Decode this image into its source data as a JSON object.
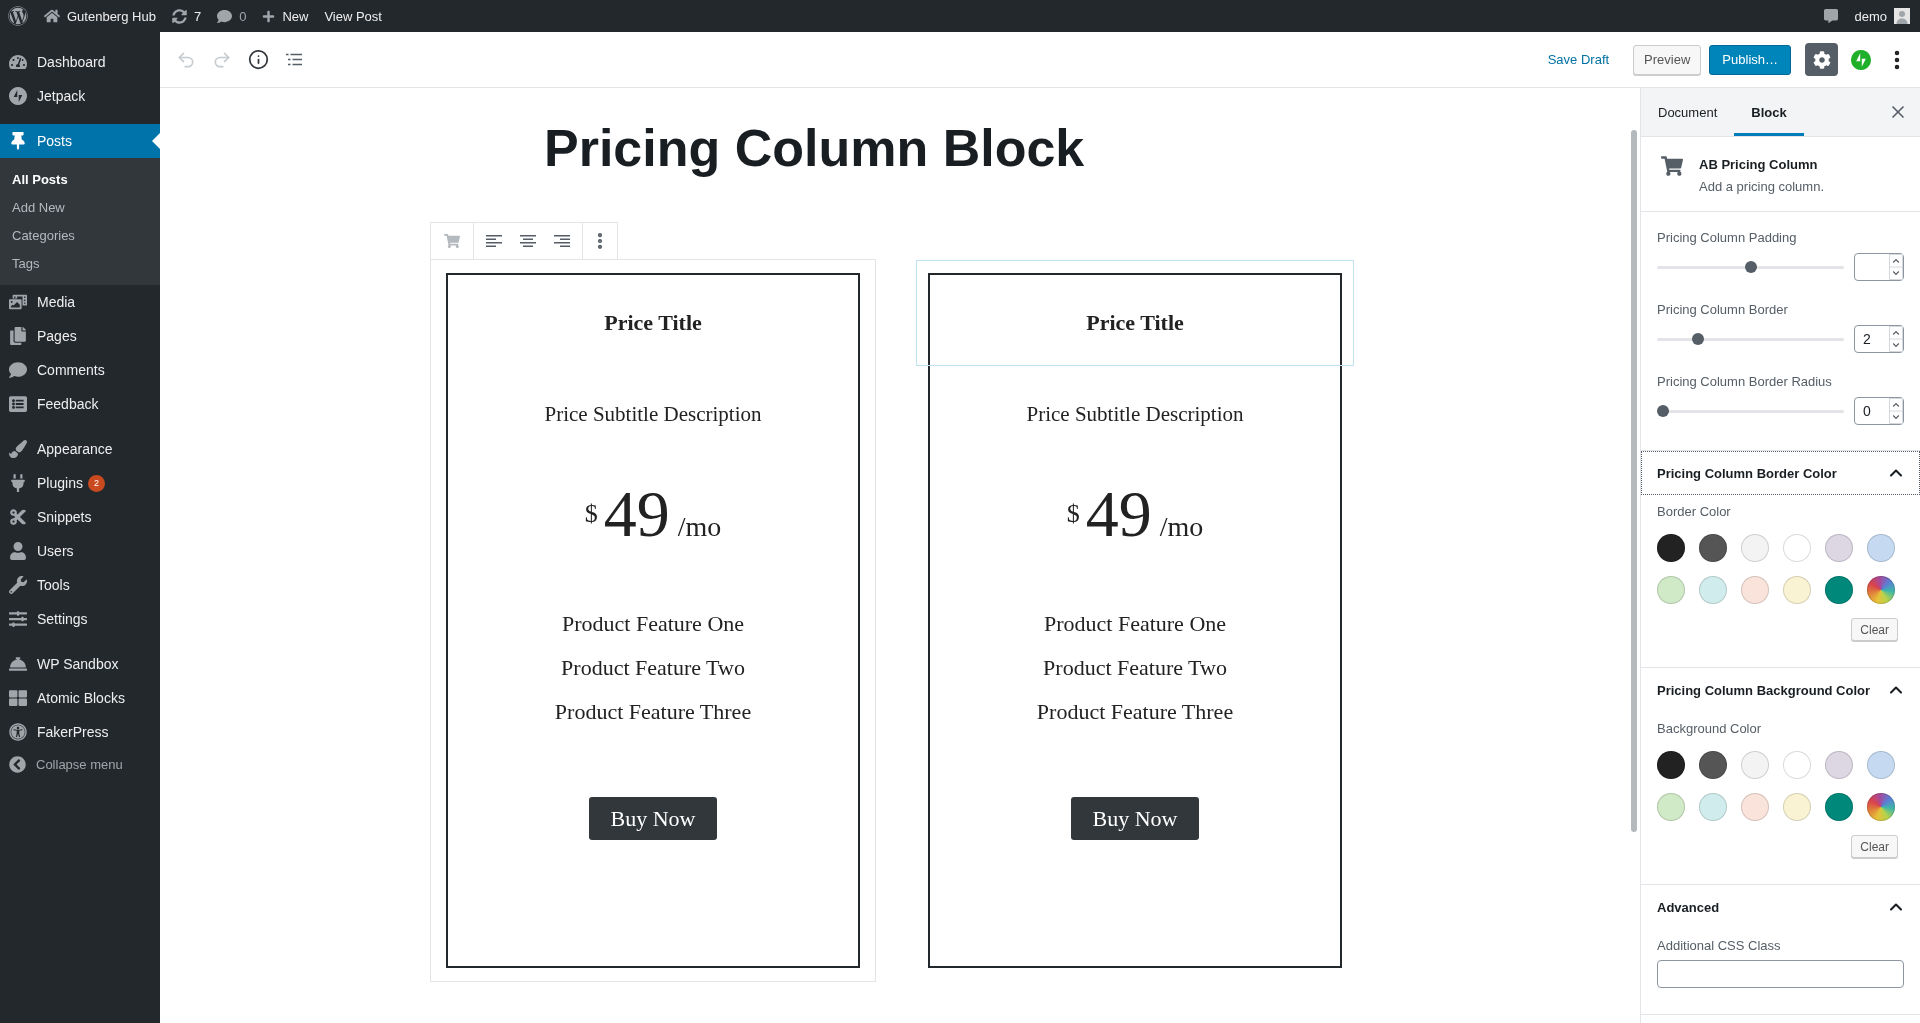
{
  "admin_bar": {
    "site_name": "Gutenberg Hub",
    "updates_count": "7",
    "comments_count": "0",
    "new_label": "New",
    "view_post_label": "View Post",
    "user_name": "demo"
  },
  "admin_menu": {
    "groups": [
      {
        "items": [
          {
            "label": "Dashboard",
            "selected": false
          },
          {
            "label": "Jetpack",
            "selected": false
          }
        ]
      },
      {
        "items": [
          {
            "label": "Posts",
            "selected": true,
            "children": [
              {
                "label": "All Posts",
                "selected": true
              },
              {
                "label": "Add New",
                "selected": false
              },
              {
                "label": "Categories",
                "selected": false
              },
              {
                "label": "Tags",
                "selected": false
              }
            ]
          },
          {
            "label": "Media",
            "selected": false
          },
          {
            "label": "Pages",
            "selected": false
          },
          {
            "label": "Comments",
            "selected": false
          },
          {
            "label": "Feedback",
            "selected": false
          }
        ]
      },
      {
        "items": [
          {
            "label": "Appearance",
            "selected": false
          },
          {
            "label": "Plugins",
            "selected": false,
            "badge": "2"
          },
          {
            "label": "Snippets",
            "selected": false
          },
          {
            "label": "Users",
            "selected": false
          },
          {
            "label": "Tools",
            "selected": false
          },
          {
            "label": "Settings",
            "selected": false
          }
        ]
      },
      {
        "items": [
          {
            "label": "WP Sandbox",
            "selected": false
          },
          {
            "label": "Atomic Blocks",
            "selected": false
          },
          {
            "label": "FakerPress",
            "selected": false
          }
        ]
      }
    ],
    "collapse_label": "Collapse menu"
  },
  "editor_toolbar": {
    "undo_disabled": true,
    "redo_disabled": true,
    "save_draft": "Save Draft",
    "preview": "Preview",
    "publish": "Publish…",
    "settings_pressed": true
  },
  "post_title": "Pricing Column Block",
  "pricing_columns": [
    {
      "selected": true,
      "title_hovered": false,
      "title": "Price Title",
      "subtitle": "Price Subtitle Description",
      "currency": "$",
      "amount": "49",
      "term": "/mo",
      "features": [
        "Product Feature One",
        "Product Feature Two",
        "Product Feature Three"
      ],
      "button": "Buy Now"
    },
    {
      "selected": false,
      "title_hovered": true,
      "title": "Price Title",
      "subtitle": "Price Subtitle Description",
      "currency": "$",
      "amount": "49",
      "term": "/mo",
      "features": [
        "Product Feature One",
        "Product Feature Two",
        "Product Feature Three"
      ],
      "button": "Buy Now"
    }
  ],
  "settings_sidebar": {
    "tabs": [
      {
        "label": "Document",
        "selected": false
      },
      {
        "label": "Block",
        "selected": true
      }
    ],
    "block_card": {
      "title": "AB Pricing Column",
      "description": "Add a pricing column."
    },
    "range_controls": [
      {
        "label": "Pricing Column Padding",
        "level": 0.5
      },
      {
        "label": "Pricing Column Border",
        "level": 0.2,
        "value": "2"
      },
      {
        "label": "Pricing Column Border Radius",
        "level": 0,
        "value": "0"
      }
    ],
    "color_panels": [
      {
        "title": "Pricing Column Border Color",
        "expanded": true,
        "focused": true,
        "label": "Border Color",
        "swatches": [
          {
            "kind": "color",
            "color": "#222222",
            "selected": false
          },
          {
            "kind": "color",
            "color": "#555555",
            "selected": false
          },
          {
            "kind": "color",
            "color": "#f3f3f3",
            "selected": false
          },
          {
            "kind": "color",
            "color": "#ffffff",
            "selected": false
          },
          {
            "kind": "color",
            "color": "#ddd7e4",
            "selected": false
          },
          {
            "kind": "color",
            "color": "#c5daf1",
            "selected": false
          },
          {
            "kind": "color",
            "color": "#d0e9c6",
            "selected": false
          },
          {
            "kind": "color",
            "color": "#d1ecec",
            "selected": false
          },
          {
            "kind": "color",
            "color": "#f9e3da",
            "selected": false
          },
          {
            "kind": "color",
            "color": "#faf3d3",
            "selected": false
          },
          {
            "kind": "color",
            "color": "#00897b",
            "selected": false
          },
          {
            "kind": "custom",
            "selected": false
          }
        ],
        "clear_label": "Clear"
      },
      {
        "title": "Pricing Column Background Color",
        "expanded": true,
        "focused": false,
        "label": "Background Color",
        "swatches": [
          {
            "kind": "color",
            "color": "#222222",
            "selected": false
          },
          {
            "kind": "color",
            "color": "#555555",
            "selected": false
          },
          {
            "kind": "color",
            "color": "#f3f3f3",
            "selected": false
          },
          {
            "kind": "color",
            "color": "#ffffff",
            "selected": false
          },
          {
            "kind": "color",
            "color": "#ddd7e4",
            "selected": false
          },
          {
            "kind": "color",
            "color": "#c5daf1",
            "selected": false
          },
          {
            "kind": "color",
            "color": "#d0e9c6",
            "selected": false
          },
          {
            "kind": "color",
            "color": "#d1ecec",
            "selected": false
          },
          {
            "kind": "color",
            "color": "#f9e3da",
            "selected": false
          },
          {
            "kind": "color",
            "color": "#faf3d3",
            "selected": false
          },
          {
            "kind": "color",
            "color": "#00897b",
            "selected": false
          },
          {
            "kind": "custom",
            "selected": false
          }
        ],
        "clear_label": "Clear"
      }
    ],
    "advanced_panel": {
      "title": "Advanced",
      "expanded": true,
      "field_label": "Additional CSS Class"
    }
  }
}
